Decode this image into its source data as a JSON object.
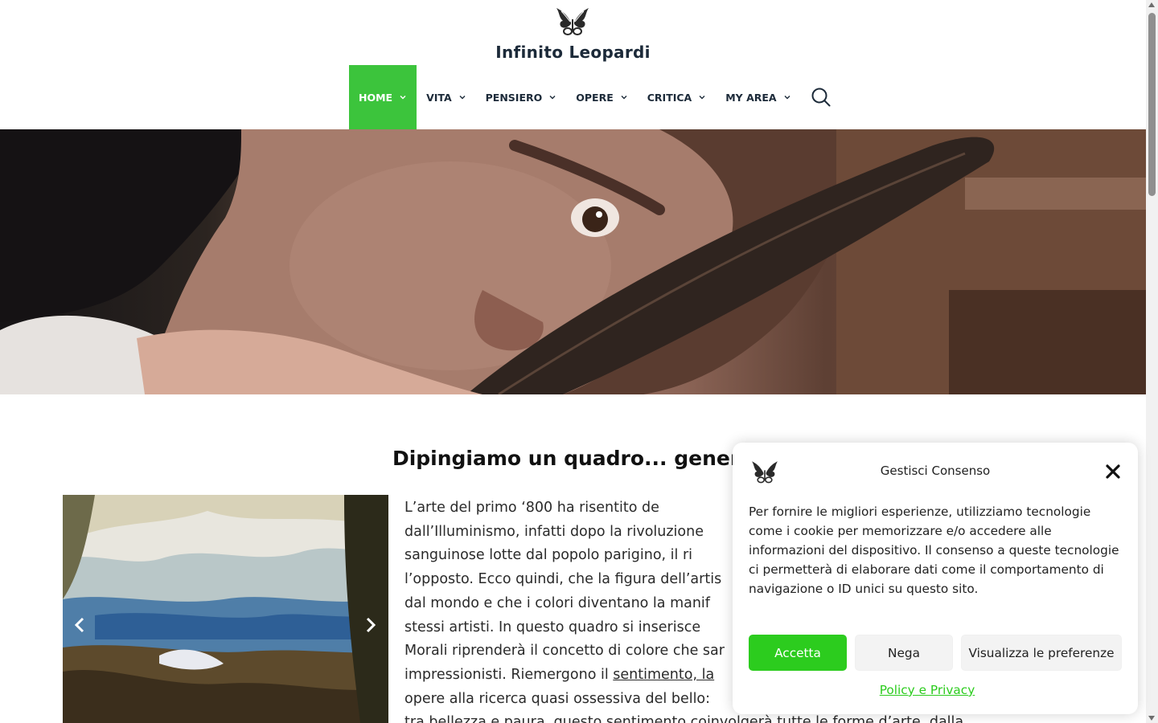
{
  "header": {
    "site_title": "Infinito Leopardi",
    "logo": "winged-butterfly-logo",
    "nav": [
      {
        "label": "HOME",
        "active": true
      },
      {
        "label": "VITA"
      },
      {
        "label": "PENSIERO"
      },
      {
        "label": "OPERE"
      },
      {
        "label": "CRITICA"
      },
      {
        "label": "MY AREA"
      }
    ],
    "search_icon": "search-icon"
  },
  "hero": {
    "image": "man-writing-with-quill-closeup"
  },
  "content": {
    "title": "Dipingiamo un quadro... genera",
    "slider": {
      "image": "romantic-landscape-painting",
      "prev_icon": "chevron-left-icon",
      "next_icon": "chevron-right-icon"
    },
    "lines": [
      "L’arte del primo ‘800 ha risentito de",
      "dall’Illuminismo, infatti dopo la rivoluzione",
      "sanguinose lotte dal popolo parigino, il ri",
      "l’opposto. Ecco quindi, che la figura dell’artis",
      "dal mondo e che i colori diventano la manif",
      "stessi artisti. In questo quadro si inserisce",
      "Morali riprenderà il concetto di colore che sar",
      "opere alla ricerca quasi ossessiva del bello:",
      "tra bellezza e paura, questo sentimento coinvolgerà tutte le forme d’arte, dalla"
    ],
    "line8_prefix": "impressionisti. Riemergono il ",
    "line8_link": "sentimento, la"
  },
  "consent": {
    "title": "Gestisci Consenso",
    "text": "Per fornire le migliori esperienze, utilizziamo tecnologie come i cookie per memorizzare e/o accedere alle informazioni del dispositivo. Il consenso a queste tecnologie ci permetterà di elaborare dati come il comportamento di navigazione o ID unici su questo sito.",
    "accept": "Accetta",
    "deny": "Nega",
    "preferences": "Visualizza le preferenze",
    "policy": "Policy e Privacy",
    "accent": "#2ccc1e"
  },
  "colors": {
    "nav_active": "#3cc43c",
    "title": "#1c2a39"
  }
}
